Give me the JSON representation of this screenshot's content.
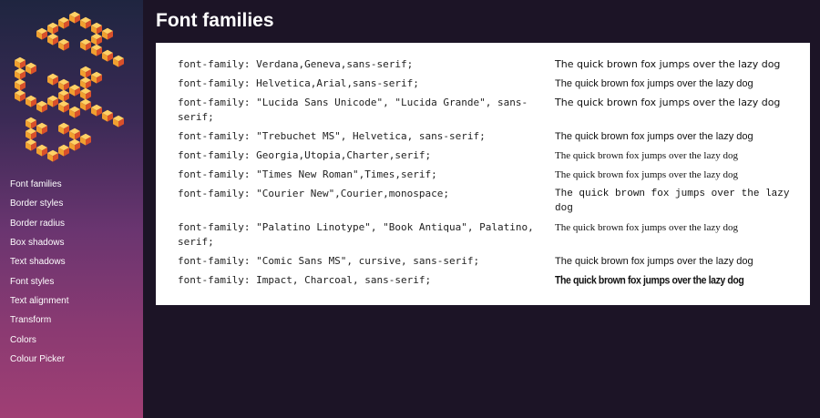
{
  "colors": {
    "page_background": "#1c1426",
    "panel_background": "#ffffff",
    "nav_text": "#ffffff",
    "logo_light": "#ffd166",
    "logo_mid": "#f0a030",
    "logo_dark": "#d9502a"
  },
  "logo": {
    "icon": "isometric-cubes-logo-icon",
    "text": "CSS COOL"
  },
  "nav": {
    "items": [
      {
        "label": "Font families"
      },
      {
        "label": "Border styles"
      },
      {
        "label": "Border radius"
      },
      {
        "label": "Box shadows"
      },
      {
        "label": "Text shadows"
      },
      {
        "label": "Font styles"
      },
      {
        "label": "Text alignment"
      },
      {
        "label": "Transform"
      },
      {
        "label": "Colors"
      },
      {
        "label": "Colour Picker"
      }
    ]
  },
  "page": {
    "title": "Font families"
  },
  "sample_text": "The quick brown fox jumps over the lazy dog",
  "rows": [
    {
      "code": "font-family: Verdana,Geneva,sans-serif;",
      "sample": "The quick brown fox jumps over the lazy dog"
    },
    {
      "code": "font-family: Helvetica,Arial,sans-serif;",
      "sample": "The quick brown fox jumps over the lazy dog"
    },
    {
      "code": "font-family: \"Lucida Sans Unicode\", \"Lucida Grande\", sans-serif;",
      "sample": "The quick brown fox jumps over the lazy dog"
    },
    {
      "code": "font-family: \"Trebuchet MS\", Helvetica, sans-serif;",
      "sample": "The quick brown fox jumps over the lazy dog"
    },
    {
      "code": "font-family: Georgia,Utopia,Charter,serif;",
      "sample": "The quick brown fox jumps over the lazy dog"
    },
    {
      "code": "font-family: \"Times New Roman\",Times,serif;",
      "sample": "The quick brown fox jumps over the lazy dog"
    },
    {
      "code": "font-family: \"Courier New\",Courier,monospace;",
      "sample": "The quick brown fox jumps over the lazy dog"
    },
    {
      "code": "font-family: \"Palatino Linotype\", \"Book Antiqua\", Palatino, serif;",
      "sample": "The quick brown fox jumps over the lazy dog"
    },
    {
      "code": "font-family: \"Comic Sans MS\", cursive, sans-serif;",
      "sample": "The quick brown fox jumps over the lazy dog"
    },
    {
      "code": "font-family: Impact, Charcoal, sans-serif;",
      "sample": "The quick brown fox jumps over the lazy dog"
    }
  ]
}
